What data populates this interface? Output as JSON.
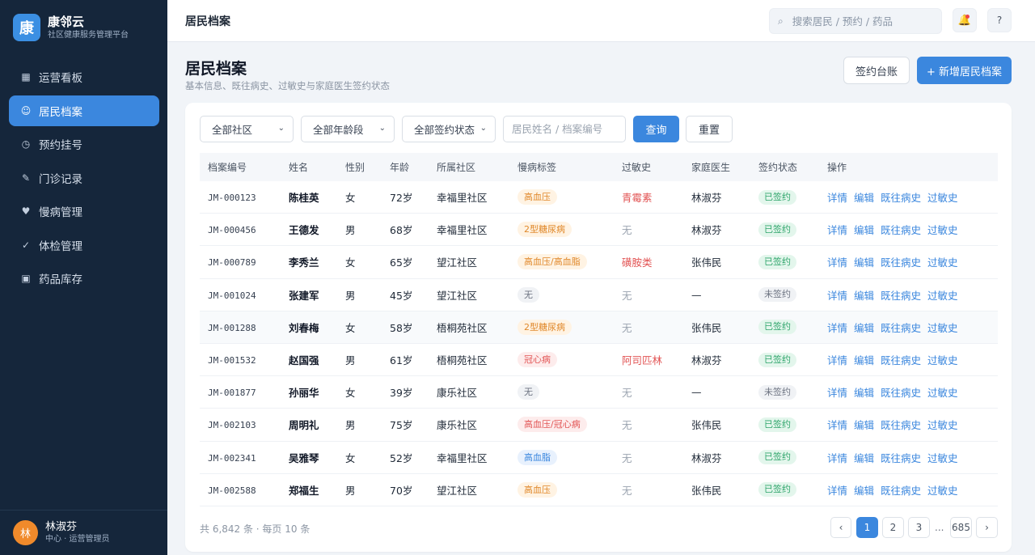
{
  "brand": {
    "logo_char": "康",
    "name": "康邻云",
    "subtitle": "社区健康服务管理平台"
  },
  "sidebar": {
    "items": [
      {
        "label": "运营看板",
        "icon": "grid-icon",
        "glyph": "▦",
        "active": false
      },
      {
        "label": "居民档案",
        "icon": "smile-icon",
        "glyph": "☺",
        "active": true
      },
      {
        "label": "预约挂号",
        "icon": "clock-icon",
        "glyph": "◷",
        "active": false
      },
      {
        "label": "门诊记录",
        "icon": "pen-icon",
        "glyph": "✎",
        "active": false
      },
      {
        "label": "慢病管理",
        "icon": "heart-icon",
        "glyph": "♥",
        "active": false
      },
      {
        "label": "体检管理",
        "icon": "check-icon",
        "glyph": "✓",
        "active": false
      },
      {
        "label": "药品库存",
        "icon": "box-icon",
        "glyph": "▣",
        "active": false
      }
    ],
    "user": {
      "avatar_char": "林",
      "name": "林淑芬",
      "role": "中心 · 运营管理员"
    }
  },
  "topbar": {
    "title": "居民档案",
    "search_placeholder": "搜索居民 / 预约 / 药品",
    "help_label": "?"
  },
  "page": {
    "title": "居民档案",
    "subtitle": "基本信息、既往病史、过敏史与家庭医生签约状态",
    "sign_ledger_label": "签约台账",
    "add_label": "+ 新增居民档案"
  },
  "filters": {
    "community": "全部社区",
    "age": "全部年龄段",
    "sign_status": "全部签约状态",
    "name_placeholder": "居民姓名 / 档案编号",
    "query_label": "查询",
    "reset_label": "重置"
  },
  "table": {
    "headers": [
      "档案编号",
      "姓名",
      "性别",
      "年龄",
      "所属社区",
      "慢病标签",
      "过敏史",
      "家庭医生",
      "签约状态",
      "操作"
    ],
    "actions": [
      "详情",
      "编辑",
      "既往病史",
      "过敏史"
    ],
    "rows": [
      {
        "id": "JM-000123",
        "name": "陈桂英",
        "gender": "女",
        "age": "72岁",
        "community": "幸福里社区",
        "tag": "高血压",
        "tag_color": "orange",
        "allergy": "青霉素",
        "allergy_type": "red",
        "doctor": "林淑芬",
        "status": "已签约",
        "signed": true
      },
      {
        "id": "JM-000456",
        "name": "王德发",
        "gender": "男",
        "age": "68岁",
        "community": "幸福里社区",
        "tag": "2型糖尿病",
        "tag_color": "orange",
        "allergy": "无",
        "allergy_type": "none",
        "doctor": "林淑芬",
        "status": "已签约",
        "signed": true
      },
      {
        "id": "JM-000789",
        "name": "李秀兰",
        "gender": "女",
        "age": "65岁",
        "community": "望江社区",
        "tag": "高血压/高血脂",
        "tag_color": "orange",
        "allergy": "磺胺类",
        "allergy_type": "red",
        "doctor": "张伟民",
        "status": "已签约",
        "signed": true
      },
      {
        "id": "JM-001024",
        "name": "张建军",
        "gender": "男",
        "age": "45岁",
        "community": "望江社区",
        "tag": "无",
        "tag_color": "gray",
        "allergy": "无",
        "allergy_type": "none",
        "doctor": "—",
        "status": "未签约",
        "signed": false
      },
      {
        "id": "JM-001288",
        "name": "刘春梅",
        "gender": "女",
        "age": "58岁",
        "community": "梧桐苑社区",
        "tag": "2型糖尿病",
        "tag_color": "orange",
        "allergy": "无",
        "allergy_type": "none",
        "doctor": "张伟民",
        "status": "已签约",
        "signed": true,
        "highlight": true
      },
      {
        "id": "JM-001532",
        "name": "赵国强",
        "gender": "男",
        "age": "61岁",
        "community": "梧桐苑社区",
        "tag": "冠心病",
        "tag_color": "red",
        "allergy": "阿司匹林",
        "allergy_type": "red",
        "doctor": "林淑芬",
        "status": "已签约",
        "signed": true
      },
      {
        "id": "JM-001877",
        "name": "孙丽华",
        "gender": "女",
        "age": "39岁",
        "community": "康乐社区",
        "tag": "无",
        "tag_color": "gray",
        "allergy": "无",
        "allergy_type": "none",
        "doctor": "—",
        "status": "未签约",
        "signed": false
      },
      {
        "id": "JM-002103",
        "name": "周明礼",
        "gender": "男",
        "age": "75岁",
        "community": "康乐社区",
        "tag": "高血压/冠心病",
        "tag_color": "red",
        "allergy": "无",
        "allergy_type": "none",
        "doctor": "张伟民",
        "status": "已签约",
        "signed": true
      },
      {
        "id": "JM-002341",
        "name": "吴雅琴",
        "gender": "女",
        "age": "52岁",
        "community": "幸福里社区",
        "tag": "高血脂",
        "tag_color": "blue",
        "allergy": "无",
        "allergy_type": "none",
        "doctor": "林淑芬",
        "status": "已签约",
        "signed": true
      },
      {
        "id": "JM-002588",
        "name": "郑福生",
        "gender": "男",
        "age": "70岁",
        "community": "望江社区",
        "tag": "高血压",
        "tag_color": "orange",
        "allergy": "无",
        "allergy_type": "none",
        "doctor": "张伟民",
        "status": "已签约",
        "signed": true
      }
    ]
  },
  "pagination": {
    "summary": "共 6,842 条 · 每页 10 条",
    "prev": "‹",
    "pages": [
      "1",
      "2",
      "3"
    ],
    "current": "1",
    "ellipsis": "...",
    "last": "685",
    "next": "›"
  },
  "colors": {
    "accent": "#3b87de",
    "sidebar_bg": "#15263b",
    "signed": "#2fa56b",
    "allergy": "#e25555"
  }
}
